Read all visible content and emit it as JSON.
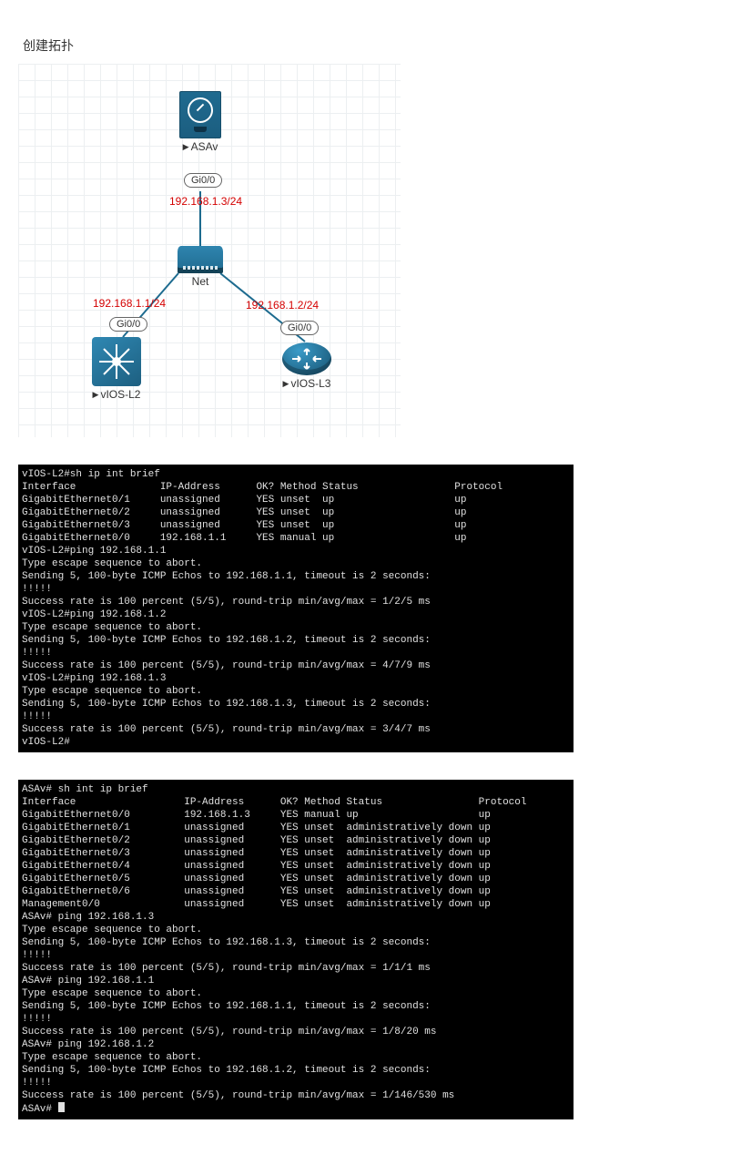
{
  "page_title": "创建拓扑",
  "topology": {
    "asa": {
      "label": "ASAv",
      "port": "Gi0/0",
      "ip": "192.168.1.3/24"
    },
    "net": {
      "label": "Net"
    },
    "vios_l2": {
      "label": "vIOS-L2",
      "port": "Gi0/0",
      "ip": "192.168.1.1/24"
    },
    "vios_l3": {
      "label": "vIOS-L3",
      "port": "Gi0/0",
      "ip": "192.168.1.2/24"
    }
  },
  "terminal1": "vIOS-L2#sh ip int brief\nInterface              IP-Address      OK? Method Status                Protocol\nGigabitEthernet0/1     unassigned      YES unset  up                    up\nGigabitEthernet0/2     unassigned      YES unset  up                    up\nGigabitEthernet0/3     unassigned      YES unset  up                    up\nGigabitEthernet0/0     192.168.1.1     YES manual up                    up\nvIOS-L2#ping 192.168.1.1\nType escape sequence to abort.\nSending 5, 100-byte ICMP Echos to 192.168.1.1, timeout is 2 seconds:\n!!!!!\nSuccess rate is 100 percent (5/5), round-trip min/avg/max = 1/2/5 ms\nvIOS-L2#ping 192.168.1.2\nType escape sequence to abort.\nSending 5, 100-byte ICMP Echos to 192.168.1.2, timeout is 2 seconds:\n!!!!!\nSuccess rate is 100 percent (5/5), round-trip min/avg/max = 4/7/9 ms\nvIOS-L2#ping 192.168.1.3\nType escape sequence to abort.\nSending 5, 100-byte ICMP Echos to 192.168.1.3, timeout is 2 seconds:\n!!!!!\nSuccess rate is 100 percent (5/5), round-trip min/avg/max = 3/4/7 ms\nvIOS-L2#",
  "terminal2": "ASAv# sh int ip brief\nInterface                  IP-Address      OK? Method Status                Protocol\nGigabitEthernet0/0         192.168.1.3     YES manual up                    up\nGigabitEthernet0/1         unassigned      YES unset  administratively down up\nGigabitEthernet0/2         unassigned      YES unset  administratively down up\nGigabitEthernet0/3         unassigned      YES unset  administratively down up\nGigabitEthernet0/4         unassigned      YES unset  administratively down up\nGigabitEthernet0/5         unassigned      YES unset  administratively down up\nGigabitEthernet0/6         unassigned      YES unset  administratively down up\nManagement0/0              unassigned      YES unset  administratively down up\nASAv# ping 192.168.1.3\nType escape sequence to abort.\nSending 5, 100-byte ICMP Echos to 192.168.1.3, timeout is 2 seconds:\n!!!!!\nSuccess rate is 100 percent (5/5), round-trip min/avg/max = 1/1/1 ms\nASAv# ping 192.168.1.1\nType escape sequence to abort.\nSending 5, 100-byte ICMP Echos to 192.168.1.1, timeout is 2 seconds:\n!!!!!\nSuccess rate is 100 percent (5/5), round-trip min/avg/max = 1/8/20 ms\nASAv# ping 192.168.1.2\nType escape sequence to abort.\nSending 5, 100-byte ICMP Echos to 192.168.1.2, timeout is 2 seconds:\n!!!!!\nSuccess rate is 100 percent (5/5), round-trip min/avg/max = 1/146/530 ms\nASAv# "
}
